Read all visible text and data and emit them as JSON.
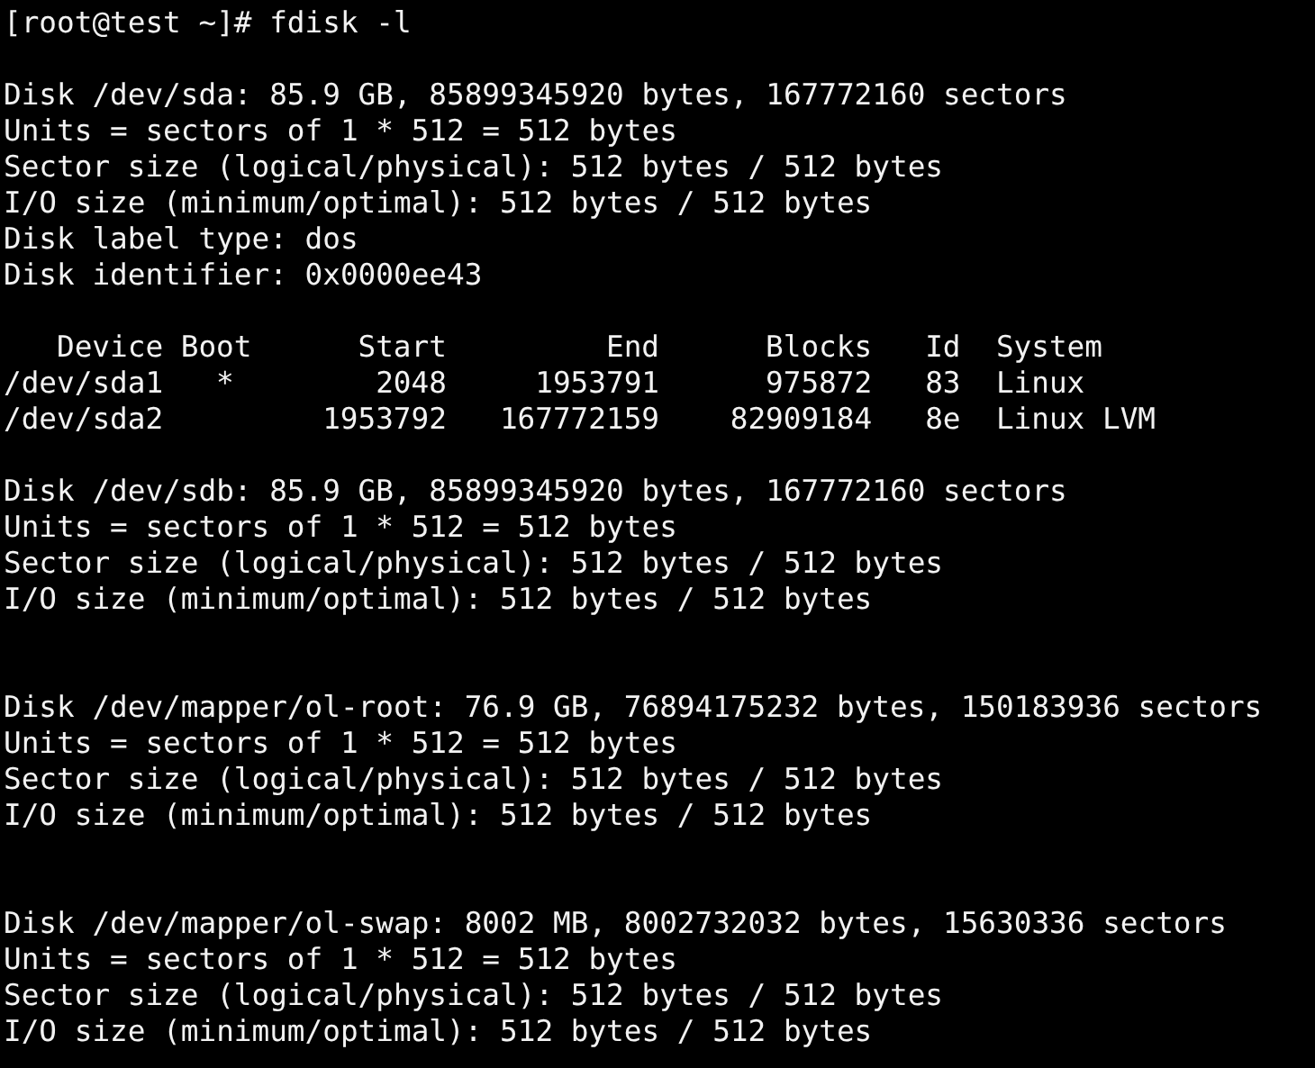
{
  "prompt": "[root@test ~]# fdisk -l",
  "disks": [
    {
      "lines": [
        "Disk /dev/sda: 85.9 GB, 85899345920 bytes, 167772160 sectors",
        "Units = sectors of 1 * 512 = 512 bytes",
        "Sector size (logical/physical): 512 bytes / 512 bytes",
        "I/O size (minimum/optimal): 512 bytes / 512 bytes",
        "Disk label type: dos",
        "Disk identifier: 0x0000ee43"
      ],
      "partition_table": {
        "columns": [
          "Device",
          "Boot",
          "Start",
          "End",
          "Blocks",
          "Id",
          "System"
        ],
        "rows": [
          [
            "/dev/sda1",
            "*",
            "2048",
            "1953791",
            "975872",
            "83",
            "Linux"
          ],
          [
            "/dev/sda2",
            "",
            "1953792",
            "167772159",
            "82909184",
            "8e",
            "Linux LVM"
          ]
        ]
      }
    },
    {
      "lines": [
        "Disk /dev/sdb: 85.9 GB, 85899345920 bytes, 167772160 sectors",
        "Units = sectors of 1 * 512 = 512 bytes",
        "Sector size (logical/physical): 512 bytes / 512 bytes",
        "I/O size (minimum/optimal): 512 bytes / 512 bytes"
      ]
    },
    {
      "lines": [
        "Disk /dev/mapper/ol-root: 76.9 GB, 76894175232 bytes, 150183936 sectors",
        "Units = sectors of 1 * 512 = 512 bytes",
        "Sector size (logical/physical): 512 bytes / 512 bytes",
        "I/O size (minimum/optimal): 512 bytes / 512 bytes"
      ]
    },
    {
      "lines": [
        "Disk /dev/mapper/ol-swap: 8002 MB, 8002732032 bytes, 15630336 sectors",
        "Units = sectors of 1 * 512 = 512 bytes",
        "Sector size (logical/physical): 512 bytes / 512 bytes",
        "I/O size (minimum/optimal): 512 bytes / 512 bytes"
      ]
    }
  ]
}
